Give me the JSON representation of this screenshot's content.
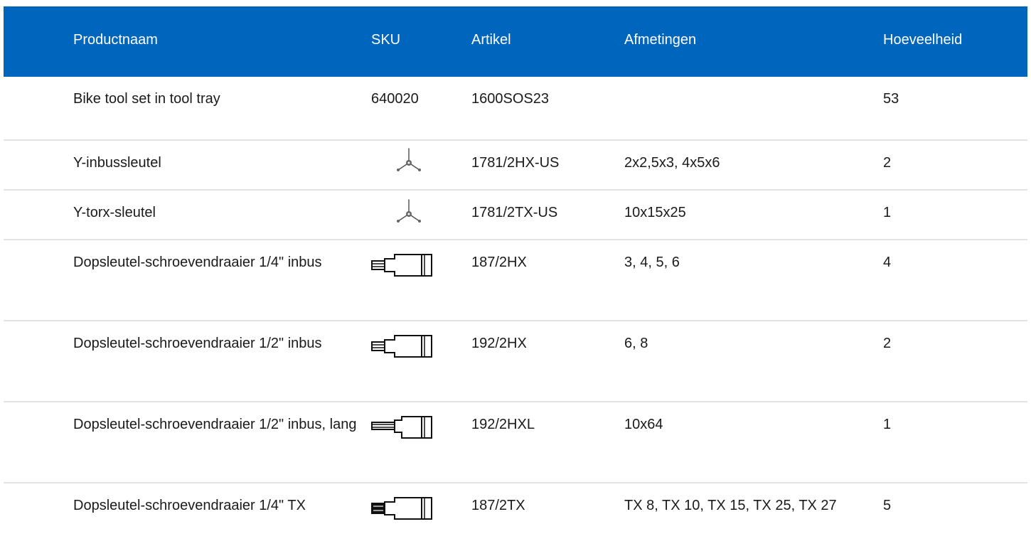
{
  "header": {
    "name": "Productnaam",
    "sku": "SKU",
    "artikel": "Artikel",
    "afmetingen": "Afmetingen",
    "hoeveelheid": "Hoeveelheid"
  },
  "colors": {
    "header_bg": "#0066bd",
    "header_text": "#ffffff",
    "divider": "#e3e3e3"
  },
  "rows": [
    {
      "name": "Bike tool set in tool tray",
      "sku": "640020",
      "icon": "",
      "artikel": "1600SOS23",
      "afmetingen": "",
      "qty": "53"
    },
    {
      "name": "Y-inbussleutel",
      "sku": "",
      "icon": "y-wrench-icon",
      "artikel": "1781/2HX-US",
      "afmetingen": "2x2,5x3, 4x5x6",
      "qty": "2"
    },
    {
      "name": "Y-torx-sleutel",
      "sku": "",
      "icon": "y-wrench-icon",
      "artikel": "1781/2TX-US",
      "afmetingen": "10x15x25",
      "qty": "1"
    },
    {
      "name": "Dopsleutel-schroevendraaier 1/4\" inbus",
      "sku": "",
      "icon": "socket-bit-icon",
      "artikel": "187/2HX",
      "afmetingen": "3, 4, 5, 6",
      "qty": "4"
    },
    {
      "name": "Dopsleutel-schroevendraaier 1/2\" inbus",
      "sku": "",
      "icon": "socket-bit-icon",
      "artikel": "192/2HX",
      "afmetingen": "6, 8",
      "qty": "2"
    },
    {
      "name": "Dopsleutel-schroevendraaier 1/2\" inbus, lang",
      "sku": "",
      "icon": "socket-bit-long-icon",
      "artikel": "192/2HXL",
      "afmetingen": "10x64",
      "qty": "1"
    },
    {
      "name": "Dopsleutel-schroevendraaier 1/4\" TX",
      "sku": "",
      "icon": "socket-bit-torx-icon",
      "artikel": "187/2TX",
      "afmetingen": "TX 8, TX 10, TX 15, TX 25, TX 27",
      "qty": "5"
    }
  ]
}
